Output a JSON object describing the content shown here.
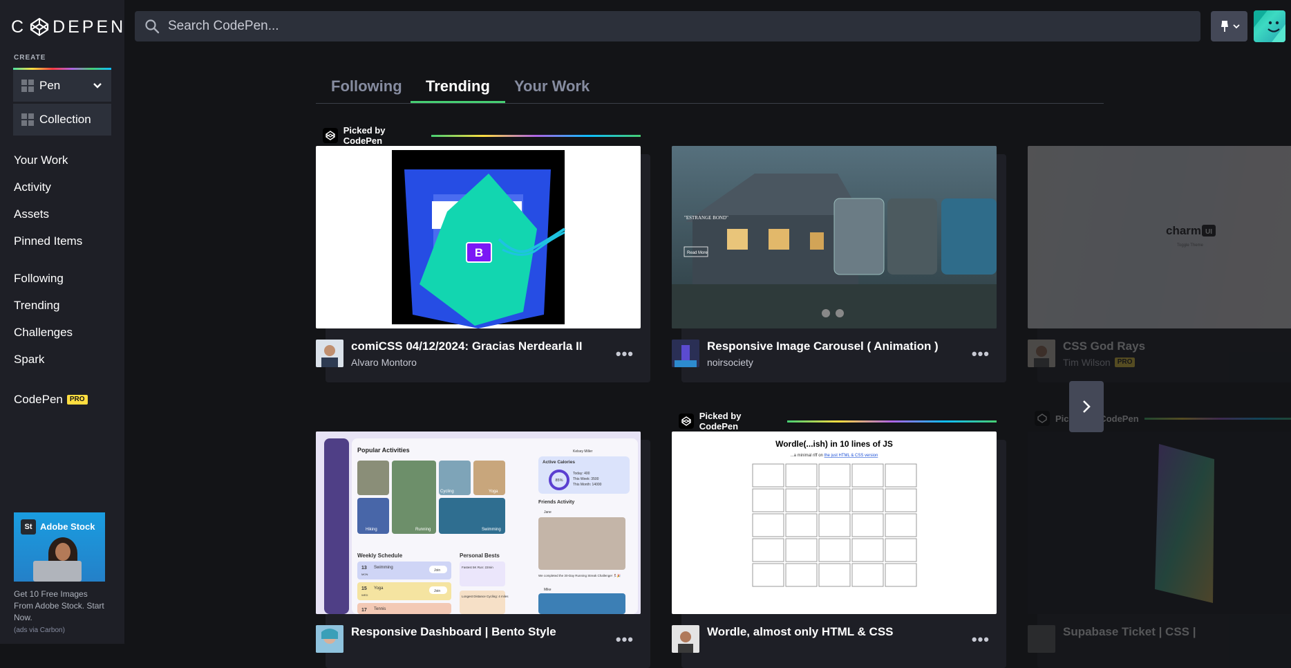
{
  "brand": {
    "logo_text": "CODEPEN"
  },
  "sidebar": {
    "create_label": "CREATE",
    "create_items": [
      {
        "label": "Pen"
      },
      {
        "label": "Collection"
      }
    ],
    "nav_group1": [
      "Your Work",
      "Activity",
      "Assets",
      "Pinned Items"
    ],
    "nav_group2": [
      "Following",
      "Trending",
      "Challenges",
      "Spark"
    ],
    "pro_link": {
      "label": "CodePen",
      "badge": "PRO"
    },
    "ad": {
      "brand": "Adobe Stock",
      "logo": "St",
      "text": "Get 10 Free Images From Adobe Stock. Start Now.",
      "via": "(ads via Carbon)"
    }
  },
  "search": {
    "placeholder": "Search CodePen..."
  },
  "tabs": [
    {
      "label": "Following"
    },
    {
      "label": "Trending"
    },
    {
      "label": "Your Work"
    }
  ],
  "picked_label": "Picked by CodePen",
  "cards": [
    {
      "title": "comiCSS 04/12/2024: Gracias Nerdearla II",
      "author": "Alvaro Montoro",
      "preview_badge": "B"
    },
    {
      "title": "Responsive Image Carousel ( Animation )",
      "author": "noirsociety",
      "preview_heading": "\"ESTRANGE BOND\"",
      "preview_button": "Read More"
    },
    {
      "title": "CSS God Rays",
      "author": "Tim Wilson",
      "author_badge": "PRO",
      "preview_logo": "charm",
      "preview_logo_suffix": "UI",
      "preview_sub": "Toggle Theme"
    },
    {
      "title": "Responsive Dashboard | Bento Style",
      "author": "",
      "preview": {
        "popular": "Popular Activities",
        "user": "Kelsey Miller",
        "active_calories": "Active Calories",
        "percent": "85%",
        "calorie_lines": [
          "Today: 400",
          "This Week: 3500",
          "This Month: 14000"
        ],
        "friends": "Friends Activity",
        "friend1": "Jane",
        "friend_note": "We completed the 30-Day Running Streak Challenge! 🏃‍♀️🎉",
        "friend2": "Mike",
        "activities": [
          "Hiking",
          "Running",
          "Cycling",
          "Yoga",
          "Swimming",
          "Tennis"
        ],
        "weekly": "Weekly Schedule",
        "bests": "Personal Bests",
        "schedule": [
          {
            "day": "13",
            "dow": "MON",
            "name": "Swimming",
            "action": "Join"
          },
          {
            "day": "15",
            "dow": "WED",
            "name": "Yoga",
            "action": "Join"
          },
          {
            "day": "17",
            "dow": "",
            "name": "Tennis",
            "action": ""
          }
        ],
        "best1": "Fastest 5K Run: 22min",
        "best2": "Longest Distance Cycling: 4 miles"
      }
    },
    {
      "title": "Wordle, almost only HTML & CSS",
      "author": "",
      "preview": {
        "heading": "Wordle(...ish) in 10 lines of JS",
        "sub_prefix": "...a minimal riff on ",
        "sub_link": "the just HTML & CSS version"
      }
    },
    {
      "title": "Supabase Ticket | CSS |",
      "author": ""
    }
  ],
  "colors": {
    "bg": "#131417",
    "sidebar": "#1e1f26",
    "accent_green": "#47cf73",
    "pro_yellow": "#ffdd40"
  },
  "icons": [
    "codepen-logo-icon",
    "search-icon",
    "pin-icon",
    "chevron-down-icon",
    "chevron-right-icon",
    "more-dots-icon"
  ]
}
